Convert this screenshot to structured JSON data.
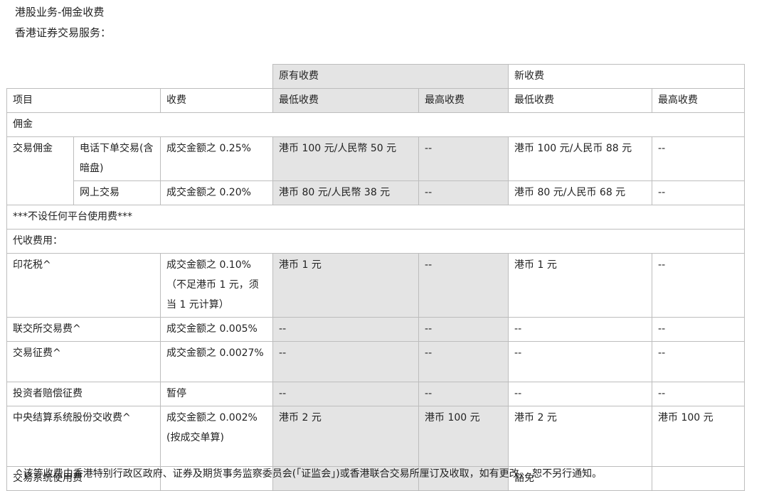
{
  "headings": {
    "title": "港股业务-佣金收费",
    "subtitle": "香港证券交易服务："
  },
  "table": {
    "group_headers": {
      "old": "原有收费",
      "new": "新收费"
    },
    "columns": {
      "item": "项目",
      "fee": "收费",
      "old_min": "最低收费",
      "old_max": "最高收费",
      "new_min": "最低收费",
      "new_max": "最高收费"
    },
    "section_commission": "佣金",
    "commission_label": "交易佣金",
    "phone": {
      "label": "电话下单交易(含暗盘)",
      "fee": "成交金额之 0.25%",
      "old_min": "港币 100 元/人民幣 50 元",
      "old_max": "--",
      "new_min": "港币 100 元/人民币 88 元",
      "new_max": "--"
    },
    "online": {
      "label": "网上交易",
      "fee": "成交金额之 0.20%",
      "old_min": "港币 80 元/人民幣 38 元",
      "old_max": "--",
      "new_min": "港币 80 元/人民币 68 元",
      "new_max": "--"
    },
    "no_platform_fee": "***不设任何平台使用费***",
    "section_collect": "代收费用：",
    "stamp": {
      "label": "印花税^",
      "fee": "成交金额之 0.10%（不足港币 1 元，须当 1 元计算）",
      "old_min": "港币 1 元",
      "old_max": "--",
      "new_min": "港币 1 元",
      "new_max": "--"
    },
    "hkex_fee": {
      "label": "联交所交易费^",
      "fee": "成交金额之 0.005%",
      "old_min": "--",
      "old_max": "--",
      "new_min": "--",
      "new_max": "--"
    },
    "levy": {
      "label": "交易征费^",
      "fee": "成交金额之 0.0027%",
      "old_min": "--",
      "old_max": "--",
      "new_min": "--",
      "new_max": "--"
    },
    "investor_levy": {
      "label": "投资者赔偿征费",
      "fee": "暂停",
      "old_min": "--",
      "old_max": "--",
      "new_min": "--",
      "new_max": "--"
    },
    "ccass": {
      "label": "中央结算系统股份交收费^",
      "fee": "成交金额之 0.002%(按成交单算)",
      "old_min": "港币 2 元",
      "old_max": "港币 100 元",
      "new_min": "港币 2 元",
      "new_max": "港币 100 元"
    },
    "system_fee": {
      "label": "交易系统使用费",
      "fee": "",
      "old_min": "",
      "old_max": "",
      "new_min": "豁免",
      "new_max": ""
    }
  },
  "footnote": "^该等收费由香港特别行政区政府、证券及期货事务监察委员会(「证监会」)或香港联合交易所厘订及收取，如有更改， 恕不另行通知。",
  "colors": {
    "gray_cell": "#e4e4e4",
    "border": "#bdbdbd",
    "text": "#222222"
  }
}
